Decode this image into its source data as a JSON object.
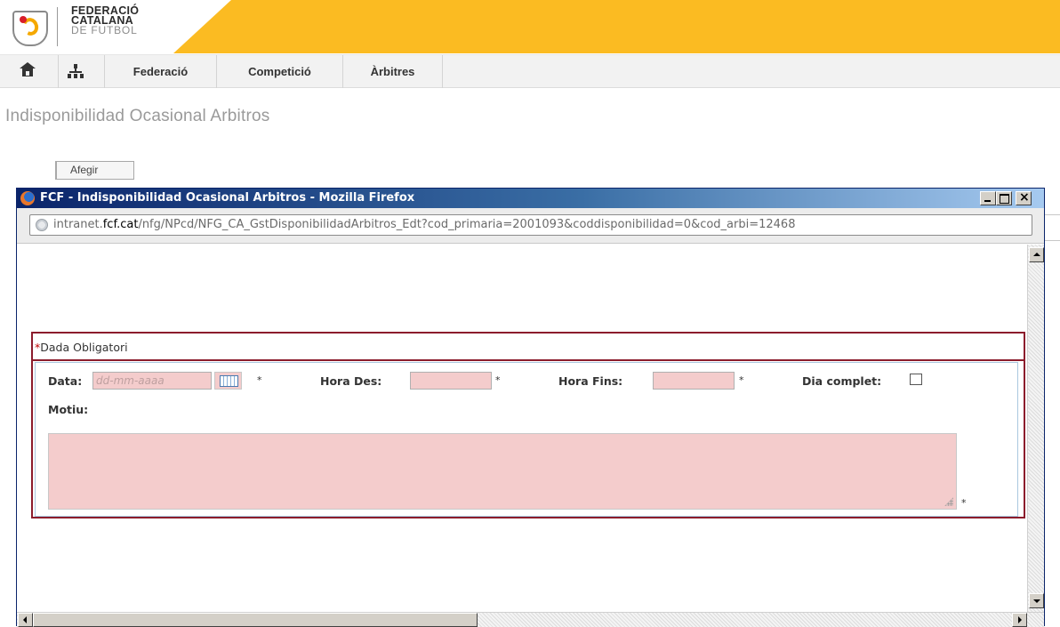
{
  "header": {
    "logo": {
      "line1": "FEDERACIÓ",
      "line2": "CATALANA",
      "line3": "DE FUTBOL"
    },
    "accent_color": "#fbbb22"
  },
  "nav": {
    "home_icon": "home-icon",
    "tree_icon": "sitemap-icon",
    "items": [
      {
        "label": "Federació"
      },
      {
        "label": "Competició"
      },
      {
        "label": "Àrbitres"
      }
    ]
  },
  "page": {
    "title": "Indisponibilidad Ocasional Arbitros",
    "add_button": "Afegir"
  },
  "popup": {
    "window_title": "FCF - Indisponibilidad Ocasional Arbitros - Mozilla Firefox",
    "url_domain_pre": "intranet.",
    "url_domain_bold": "fcf.cat",
    "url_path": "/nfg/NPcd/NFG_CA_GstDisponibilidadArbitros_Edt?cod_primaria=2001093&coddisponibilidad=0&cod_arbi=1246",
    "url_cut": "8"
  },
  "form": {
    "required_star": "*",
    "required_note": "Dada Obligatori",
    "data_label": "Data:",
    "data_placeholder": "dd-mm-aaaa",
    "hora_des_label": "Hora Des:",
    "hora_fins_label": "Hora Fins:",
    "dia_complet_label": "Dia complet:",
    "motiu_label": "Motiu:",
    "star": "*",
    "required_field_color": "#f4cccc"
  }
}
